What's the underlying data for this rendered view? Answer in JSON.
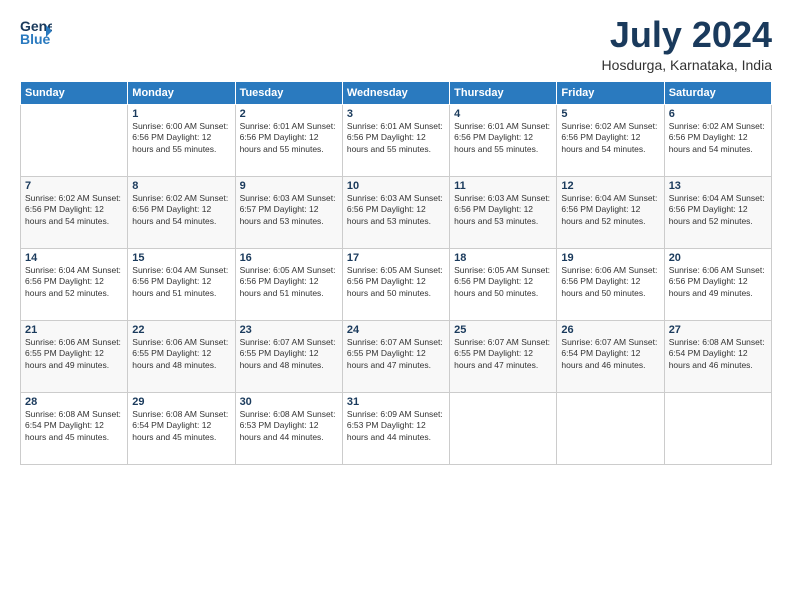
{
  "logo": {
    "line1": "General",
    "line2": "Blue",
    "arrow": "▶"
  },
  "title": "July 2024",
  "subtitle": "Hosdurga, Karnataka, India",
  "days_of_week": [
    "Sunday",
    "Monday",
    "Tuesday",
    "Wednesday",
    "Thursday",
    "Friday",
    "Saturday"
  ],
  "weeks": [
    [
      {
        "date": "",
        "content": ""
      },
      {
        "date": "1",
        "content": "Sunrise: 6:00 AM\nSunset: 6:56 PM\nDaylight: 12 hours\nand 55 minutes."
      },
      {
        "date": "2",
        "content": "Sunrise: 6:01 AM\nSunset: 6:56 PM\nDaylight: 12 hours\nand 55 minutes."
      },
      {
        "date": "3",
        "content": "Sunrise: 6:01 AM\nSunset: 6:56 PM\nDaylight: 12 hours\nand 55 minutes."
      },
      {
        "date": "4",
        "content": "Sunrise: 6:01 AM\nSunset: 6:56 PM\nDaylight: 12 hours\nand 55 minutes."
      },
      {
        "date": "5",
        "content": "Sunrise: 6:02 AM\nSunset: 6:56 PM\nDaylight: 12 hours\nand 54 minutes."
      },
      {
        "date": "6",
        "content": "Sunrise: 6:02 AM\nSunset: 6:56 PM\nDaylight: 12 hours\nand 54 minutes."
      }
    ],
    [
      {
        "date": "7",
        "content": "Sunrise: 6:02 AM\nSunset: 6:56 PM\nDaylight: 12 hours\nand 54 minutes."
      },
      {
        "date": "8",
        "content": "Sunrise: 6:02 AM\nSunset: 6:56 PM\nDaylight: 12 hours\nand 54 minutes."
      },
      {
        "date": "9",
        "content": "Sunrise: 6:03 AM\nSunset: 6:57 PM\nDaylight: 12 hours\nand 53 minutes."
      },
      {
        "date": "10",
        "content": "Sunrise: 6:03 AM\nSunset: 6:56 PM\nDaylight: 12 hours\nand 53 minutes."
      },
      {
        "date": "11",
        "content": "Sunrise: 6:03 AM\nSunset: 6:56 PM\nDaylight: 12 hours\nand 53 minutes."
      },
      {
        "date": "12",
        "content": "Sunrise: 6:04 AM\nSunset: 6:56 PM\nDaylight: 12 hours\nand 52 minutes."
      },
      {
        "date": "13",
        "content": "Sunrise: 6:04 AM\nSunset: 6:56 PM\nDaylight: 12 hours\nand 52 minutes."
      }
    ],
    [
      {
        "date": "14",
        "content": "Sunrise: 6:04 AM\nSunset: 6:56 PM\nDaylight: 12 hours\nand 52 minutes."
      },
      {
        "date": "15",
        "content": "Sunrise: 6:04 AM\nSunset: 6:56 PM\nDaylight: 12 hours\nand 51 minutes."
      },
      {
        "date": "16",
        "content": "Sunrise: 6:05 AM\nSunset: 6:56 PM\nDaylight: 12 hours\nand 51 minutes."
      },
      {
        "date": "17",
        "content": "Sunrise: 6:05 AM\nSunset: 6:56 PM\nDaylight: 12 hours\nand 50 minutes."
      },
      {
        "date": "18",
        "content": "Sunrise: 6:05 AM\nSunset: 6:56 PM\nDaylight: 12 hours\nand 50 minutes."
      },
      {
        "date": "19",
        "content": "Sunrise: 6:06 AM\nSunset: 6:56 PM\nDaylight: 12 hours\nand 50 minutes."
      },
      {
        "date": "20",
        "content": "Sunrise: 6:06 AM\nSunset: 6:56 PM\nDaylight: 12 hours\nand 49 minutes."
      }
    ],
    [
      {
        "date": "21",
        "content": "Sunrise: 6:06 AM\nSunset: 6:55 PM\nDaylight: 12 hours\nand 49 minutes."
      },
      {
        "date": "22",
        "content": "Sunrise: 6:06 AM\nSunset: 6:55 PM\nDaylight: 12 hours\nand 48 minutes."
      },
      {
        "date": "23",
        "content": "Sunrise: 6:07 AM\nSunset: 6:55 PM\nDaylight: 12 hours\nand 48 minutes."
      },
      {
        "date": "24",
        "content": "Sunrise: 6:07 AM\nSunset: 6:55 PM\nDaylight: 12 hours\nand 47 minutes."
      },
      {
        "date": "25",
        "content": "Sunrise: 6:07 AM\nSunset: 6:55 PM\nDaylight: 12 hours\nand 47 minutes."
      },
      {
        "date": "26",
        "content": "Sunrise: 6:07 AM\nSunset: 6:54 PM\nDaylight: 12 hours\nand 46 minutes."
      },
      {
        "date": "27",
        "content": "Sunrise: 6:08 AM\nSunset: 6:54 PM\nDaylight: 12 hours\nand 46 minutes."
      }
    ],
    [
      {
        "date": "28",
        "content": "Sunrise: 6:08 AM\nSunset: 6:54 PM\nDaylight: 12 hours\nand 45 minutes."
      },
      {
        "date": "29",
        "content": "Sunrise: 6:08 AM\nSunset: 6:54 PM\nDaylight: 12 hours\nand 45 minutes."
      },
      {
        "date": "30",
        "content": "Sunrise: 6:08 AM\nSunset: 6:53 PM\nDaylight: 12 hours\nand 44 minutes."
      },
      {
        "date": "31",
        "content": "Sunrise: 6:09 AM\nSunset: 6:53 PM\nDaylight: 12 hours\nand 44 minutes."
      },
      {
        "date": "",
        "content": ""
      },
      {
        "date": "",
        "content": ""
      },
      {
        "date": "",
        "content": ""
      }
    ]
  ]
}
